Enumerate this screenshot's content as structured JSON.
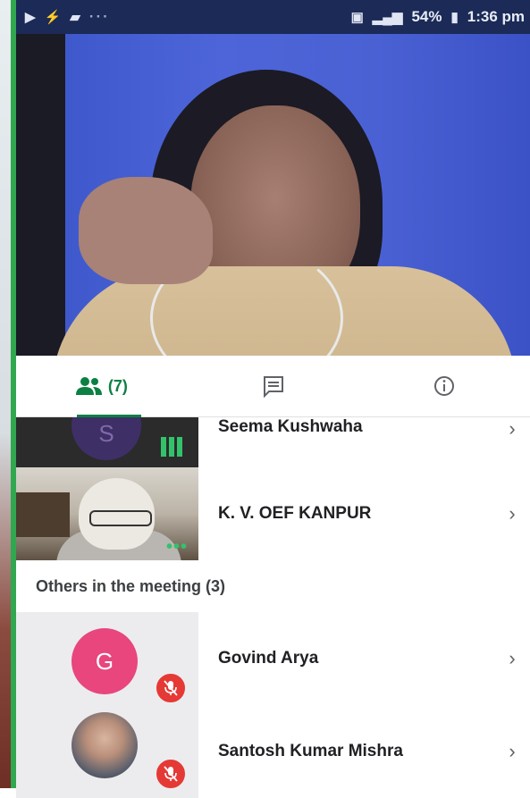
{
  "status_bar": {
    "battery": "54%",
    "time": "1:36 pm",
    "icons": [
      "video-call-icon",
      "usb-icon",
      "message-icon",
      "cast-icon",
      "signal-icon"
    ]
  },
  "tabs": {
    "people_count": "(7)",
    "icons": [
      "people-icon",
      "chat-icon",
      "info-icon"
    ]
  },
  "participants": [
    {
      "name": "Seema Kushwaha",
      "avatar_letter": "S"
    },
    {
      "name": "K. V. OEF KANPUR"
    }
  ],
  "others_section": {
    "title": "Others in the meeting (3)"
  },
  "others": [
    {
      "name": "Govind Arya",
      "avatar_letter": "G",
      "muted": true
    },
    {
      "name": "Santosh Kumar Mishra",
      "muted": true
    }
  ],
  "colors": {
    "accent_green": "#0b8043",
    "avatar_pink": "#e8467c",
    "mute_red": "#e53935",
    "status_bar": "#1b2a56"
  }
}
